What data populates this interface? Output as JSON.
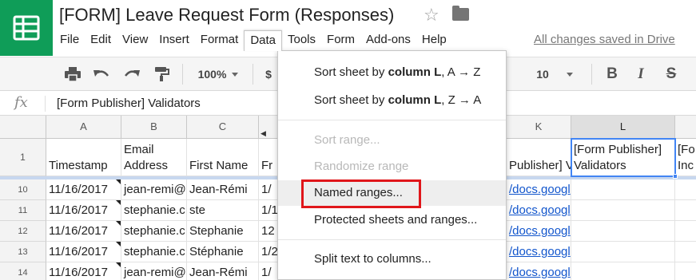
{
  "app": {
    "doc_title": "[FORM] Leave Request Form (Responses)",
    "save_status": "All changes saved in Drive",
    "brand_color": "#0f9d58"
  },
  "menus": [
    "File",
    "Edit",
    "View",
    "Insert",
    "Format",
    "Data",
    "Tools",
    "Form",
    "Add-ons",
    "Help"
  ],
  "toolbar": {
    "zoom": "100%",
    "currency": "$",
    "font_size": "10",
    "icons": [
      "print-icon",
      "undo-icon",
      "redo-icon",
      "paint-format-icon",
      "bold-icon",
      "italic-icon",
      "strikethrough-icon"
    ]
  },
  "formula_bar": {
    "fx": "fx",
    "content": "[Form Publisher] Validators"
  },
  "columns": {
    "A": "A",
    "B": "B",
    "C": "C",
    "K": "K",
    "L": "L"
  },
  "header_row": {
    "row_number": "1",
    "a": "Timestamp",
    "b_line1": "Email",
    "b_line2": "Address",
    "c": "First Name",
    "d": "Fr",
    "k": "Publisher] V",
    "l_line1": "[Form Publisher]",
    "l_line2": "Validators",
    "m_line1": "[Fo",
    "m_line2": "Inc"
  },
  "rows": [
    {
      "num": "10",
      "a": "11/16/2017",
      "b": "jean-remi@",
      "c": "Jean-Rémi",
      "d": "1/",
      "k": "/docs.googl"
    },
    {
      "num": "11",
      "a": "11/16/2017",
      "b": "stephanie.c",
      "c": "ste",
      "d": "1/1",
      "k": "/docs.googl"
    },
    {
      "num": "12",
      "a": "11/16/2017",
      "b": "stephanie.c",
      "c": "Stephanie",
      "d": "12",
      "k": "/docs.googl"
    },
    {
      "num": "13",
      "a": "11/16/2017",
      "b": "stephanie.c",
      "c": "Stéphanie",
      "d": "1/2",
      "k": "/docs.googl"
    },
    {
      "num": "14",
      "a": "11/16/2017",
      "b": "jean-remi@",
      "c": "Jean-Rémi",
      "d": "1/",
      "k": "/docs.googl"
    }
  ],
  "data_menu": {
    "sort_az_prefix": "Sort sheet by ",
    "sort_az_bold": "column L",
    "sort_az_suffix": ", A → Z",
    "sort_za_prefix": "Sort sheet by ",
    "sort_za_bold": "column L",
    "sort_za_suffix": ", Z → A",
    "sort_range": "Sort range...",
    "randomize_range": "Randomize range",
    "named_ranges": "Named ranges...",
    "protected_sheets": "Protected sheets and ranges...",
    "split_text": "Split text to columns..."
  },
  "colors": {
    "selection": "#4285f4",
    "highlight": "#e0161a",
    "link": "#1155cc"
  }
}
